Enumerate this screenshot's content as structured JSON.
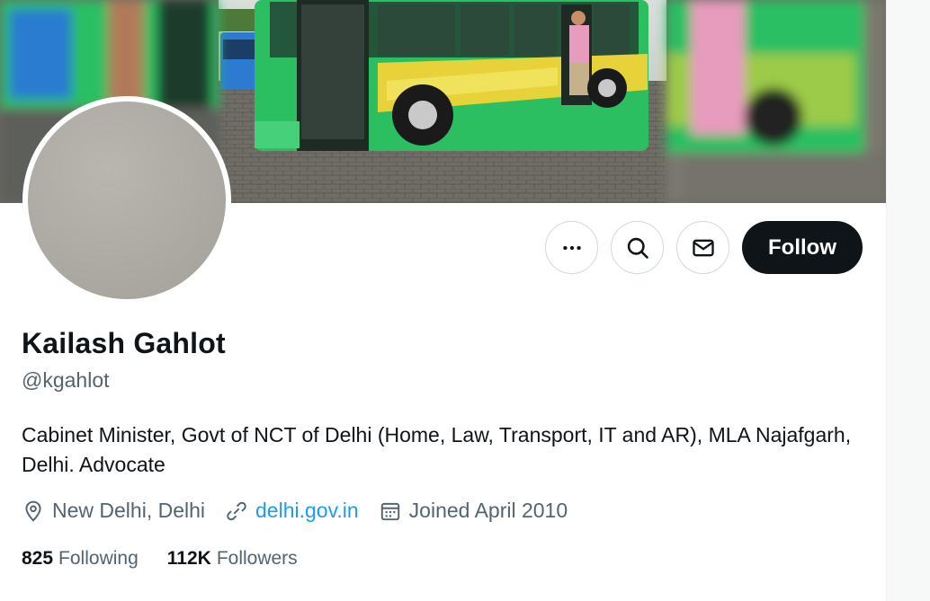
{
  "profile": {
    "name": "Kailash Gahlot",
    "handle": "@kgahlot",
    "bio": "Cabinet Minister, Govt of NCT of Delhi (Home, Law, Transport, IT and AR), MLA Najafgarh, Delhi. Advocate",
    "location": "New Delhi, Delhi",
    "website": "delhi.gov.in",
    "joined": "Joined April 2010",
    "following_count": "825",
    "following_label": "Following",
    "followers_count": "112K",
    "followers_label": "Followers"
  },
  "actions": {
    "more_icon": "more-icon",
    "search_icon": "search-icon",
    "message_icon": "envelope-icon",
    "follow_label": "Follow"
  },
  "colors": {
    "primary_text": "#0f1419",
    "secondary_text": "#536471",
    "link": "#1d9bf0",
    "follow_bg": "#0f1419",
    "bus_green": "#2bbf62",
    "bus_yellow": "#e7d23a"
  }
}
